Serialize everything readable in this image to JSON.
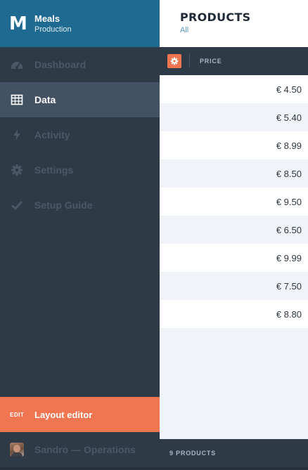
{
  "brand": {
    "logo": "M",
    "name": "Meals",
    "environment": "Production"
  },
  "nav": {
    "items": [
      {
        "label": "Dashboard",
        "icon": "dashboard-icon",
        "active": false
      },
      {
        "label": "Data",
        "icon": "table-icon",
        "active": true
      },
      {
        "label": "Activity",
        "icon": "bolt-icon",
        "active": false
      },
      {
        "label": "Settings",
        "icon": "gear-icon",
        "active": false
      },
      {
        "label": "Setup Guide",
        "icon": "check-icon",
        "active": false
      }
    ]
  },
  "edit_bar": {
    "tag": "EDIT",
    "label": "Layout editor"
  },
  "user": {
    "name": "Sandro — Operations",
    "avatar_icon": "avatar"
  },
  "header": {
    "title": "PRODUCTS",
    "subtitle": "All"
  },
  "table": {
    "settings_icon": "gear-icon",
    "column": "PRICE",
    "rows": [
      "€ 4.50",
      "€ 5.40",
      "€ 8.99",
      "€ 8.50",
      "€ 9.50",
      "€ 6.50",
      "€ 9.99",
      "€ 7.50",
      "€ 8.80"
    ]
  },
  "footer": {
    "count": "9 PRODUCTS"
  },
  "colors": {
    "brand": "#1e6a91",
    "sidebar": "#2f3a47",
    "active": "#435262",
    "accent": "#f07551",
    "link": "#5b95c0"
  }
}
